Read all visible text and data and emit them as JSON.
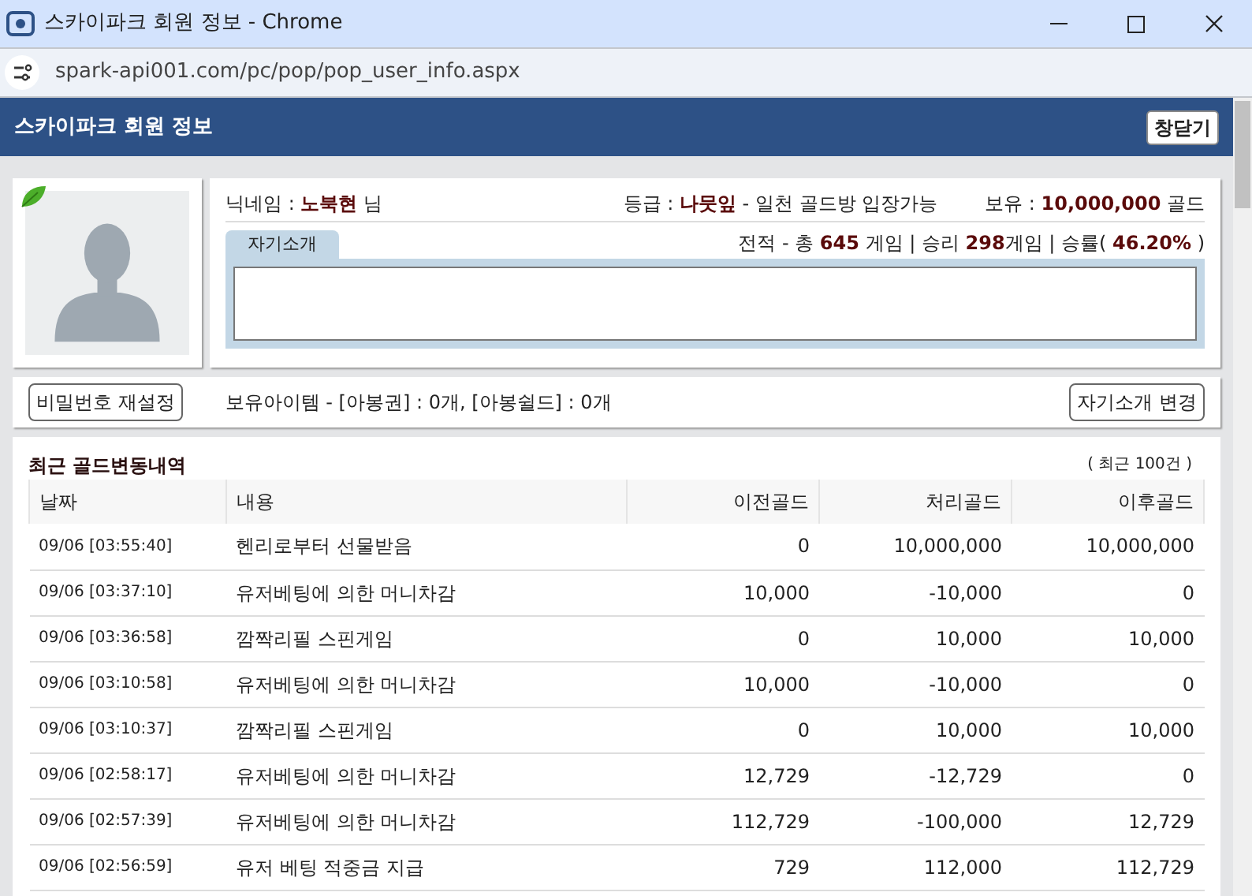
{
  "window": {
    "title": "스카이파크 회원 정보 - Chrome"
  },
  "address_bar": {
    "url": "spark-api001.com/pc/pop/pop_user_info.aspx"
  },
  "header": {
    "title": "스카이파크 회원 정보",
    "close_button": "창닫기"
  },
  "profile": {
    "nickname": "닉네임 : **노북현** 님",
    "grade": "등급 : **나뭇잎** - 일천 골드방 입장가능",
    "holdings": "보유 : **10,000,000** 골드",
    "record": "전적 - 총 **645** 게임 | 승리 **298**게임 | 승률( **46.20%** )",
    "intro_tab": "자기소개"
  },
  "actions": {
    "reset_password": "비밀번호 재설정",
    "items": "보유아이템 - [아봉권] : 0개, [아봉쉴드] : 0개",
    "change_intro": "자기소개 변경"
  },
  "history": {
    "title": "최근 골드변동내역",
    "count": "( 최근 100건 )",
    "columns": [
      "날짜",
      "내용",
      "이전골드",
      "처리골드",
      "이후골드"
    ],
    "rows": [
      [
        "09/06 [03:55:40]",
        "헨리로부터 선물받음",
        "0",
        "10,000,000",
        "10,000,000"
      ],
      [
        "09/06 [03:37:10]",
        "유저베팅에 의한 머니차감",
        "10,000",
        "-10,000",
        "0"
      ],
      [
        "09/06 [03:36:58]",
        "깜짝리필 스핀게임",
        "0",
        "10,000",
        "10,000"
      ],
      [
        "09/06 [03:10:58]",
        "유저베팅에 의한 머니차감",
        "10,000",
        "-10,000",
        "0"
      ],
      [
        "09/06 [03:10:37]",
        "깜짝리필 스핀게임",
        "0",
        "10,000",
        "10,000"
      ],
      [
        "09/06 [02:58:17]",
        "유저베팅에 의한 머니차감",
        "12,729",
        "-12,729",
        "0"
      ],
      [
        "09/06 [02:57:39]",
        "유저베팅에 의한 머니차감",
        "112,729",
        "-100,000",
        "12,729"
      ],
      [
        "09/06 [02:56:59]",
        "유저 베팅 적중금 지급",
        "729",
        "112,000",
        "112,729"
      ]
    ]
  }
}
